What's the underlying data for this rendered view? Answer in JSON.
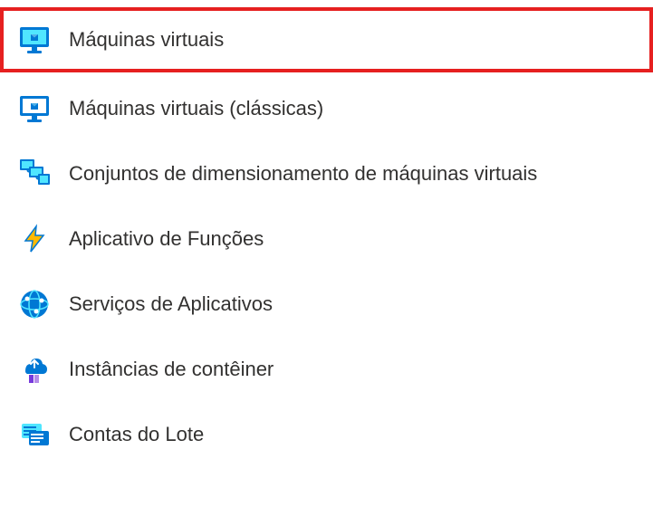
{
  "menu": {
    "items": [
      {
        "label": "Máquinas virtuais",
        "highlighted": true
      },
      {
        "label": "Máquinas virtuais (clássicas)",
        "highlighted": false
      },
      {
        "label": "Conjuntos de dimensionamento de máquinas virtuais",
        "highlighted": false
      },
      {
        "label": "Aplicativo de Funções",
        "highlighted": false
      },
      {
        "label": "Serviços de Aplicativos",
        "highlighted": false
      },
      {
        "label": "Instâncias de contêiner",
        "highlighted": false
      },
      {
        "label": "Contas do Lote",
        "highlighted": false
      }
    ]
  }
}
